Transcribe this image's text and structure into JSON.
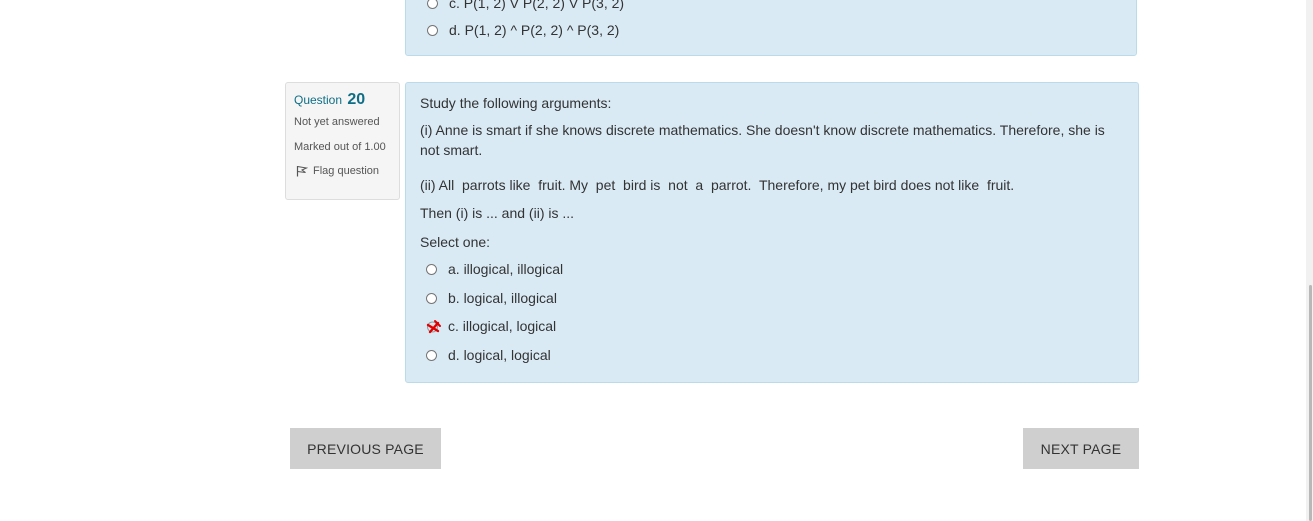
{
  "previous_question": {
    "options": [
      {
        "label": "c. P(1, 2) V P(2, 2) V P(3, 2)"
      },
      {
        "label": "d. P(1, 2) ^ P(2, 2) ^ P(3, 2)"
      }
    ]
  },
  "question": {
    "number_label": "Question",
    "number": "20",
    "state": "Not yet answered",
    "grade": "Marked out of 1.00",
    "flag_label": "Flag question",
    "text": {
      "intro": "Study the following arguments:",
      "arg1": "(i) Anne is smart if she knows discrete mathematics. She doesn't know discrete mathematics. Therefore, she is not smart.",
      "arg2": "(ii) All  parrots like  fruit. My  pet  bird is  not  a  parrot.  Therefore, my pet bird does not like  fruit.",
      "conclusion": "Then (i) is ... and (ii) is ..."
    },
    "prompt": "Select one:",
    "options": [
      {
        "label": "a. illogical, illogical",
        "selected": false
      },
      {
        "label": "b. logical, illogical",
        "selected": false
      },
      {
        "label": "c. illogical, logical",
        "selected": true,
        "marked": "incorrect"
      },
      {
        "label": "d. logical, logical",
        "selected": false
      }
    ]
  },
  "navigation": {
    "previous_label": "PREVIOUS PAGE",
    "next_label": "NEXT PAGE"
  },
  "colors": {
    "content_bg": "#d9eaf5",
    "accent": "#0f6e86",
    "button_bg": "#cfcfcf",
    "incorrect": "#e00000"
  }
}
